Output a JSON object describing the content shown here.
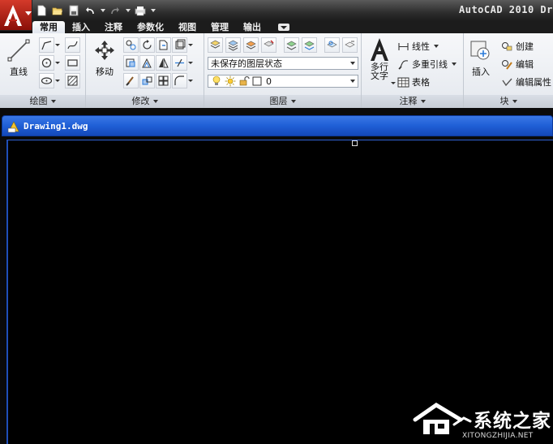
{
  "window": {
    "title": "AutoCAD 2010  Dr"
  },
  "quick_access": {
    "items": [
      {
        "icon": "new-icon"
      },
      {
        "icon": "open-icon"
      },
      {
        "icon": "save-icon"
      },
      {
        "icon": "undo-icon"
      },
      {
        "icon": "redo-icon"
      },
      {
        "icon": "plot-icon"
      }
    ]
  },
  "ribbon": {
    "tabs": [
      {
        "label": "常用",
        "active": true
      },
      {
        "label": "插入"
      },
      {
        "label": "注释"
      },
      {
        "label": "参数化"
      },
      {
        "label": "视图"
      },
      {
        "label": "管理"
      },
      {
        "label": "输出"
      }
    ],
    "panels": {
      "draw": {
        "title": "绘图",
        "line_label": "直线"
      },
      "modify": {
        "title": "修改",
        "move_label": "移动"
      },
      "layers": {
        "title": "图层",
        "layer_state": "未保存的图层状态",
        "current_layer": "0"
      },
      "annotation": {
        "title": "注释",
        "mtext_label_line1": "多行",
        "mtext_label_line2": "文字",
        "linear_label": "线性",
        "multileader_label": "多重引线",
        "table_label": "表格"
      },
      "block": {
        "title": "块",
        "insert_label": "插入",
        "create_label": "创建",
        "edit_label": "编辑",
        "edit_attributes_label": "编辑属性"
      }
    }
  },
  "document": {
    "filename": "Drawing1.dwg"
  },
  "watermark": {
    "brand": "系统之家",
    "url": "XITONGZHIJIA.NET"
  },
  "colors": {
    "app_button": "#c0281c",
    "titlebar": "#2d2d2d",
    "doc_titlebar": "#1f5fd6",
    "canvas": "#000000"
  }
}
